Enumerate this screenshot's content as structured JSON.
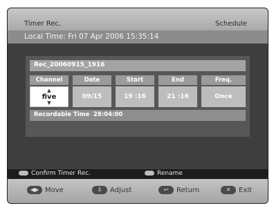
{
  "header": {
    "title": "Timer Rec.",
    "mode": "Schedule",
    "local_time": "Local Time: Fri 07 Apr 2006 15:35:14"
  },
  "recording": {
    "name": "Rec_20060915_1916",
    "columns": [
      "Channel",
      "Date",
      "Start",
      "End",
      "Freq."
    ],
    "channel": "five",
    "date": "09/15",
    "start": "19 :16",
    "end": "21 :16",
    "freq": "Once",
    "recordable_label": "Recordable Time",
    "recordable_value": "28:04:00"
  },
  "hints": {
    "confirm": "Confirm Timer Rec.",
    "rename": "Rename"
  },
  "nav": {
    "move": "Move",
    "adjust": "Adjust",
    "return": "Return",
    "exit": "Exit"
  },
  "icons": {
    "move": "ok-button-icon",
    "adjust": "up-down-icon",
    "return": "return-icon",
    "exit": "exit-icon",
    "channel_up": "up-arrow-icon",
    "channel_down": "down-arrow-icon"
  },
  "colors": {
    "screen_bg": "#3e3e3e",
    "title_bar": "#b9b9b9",
    "time_bar": "#8c8c8c",
    "header_cell": "#9b9b9b",
    "value_cell": "#bdbdbd",
    "selected_cell": "#ffffff"
  }
}
